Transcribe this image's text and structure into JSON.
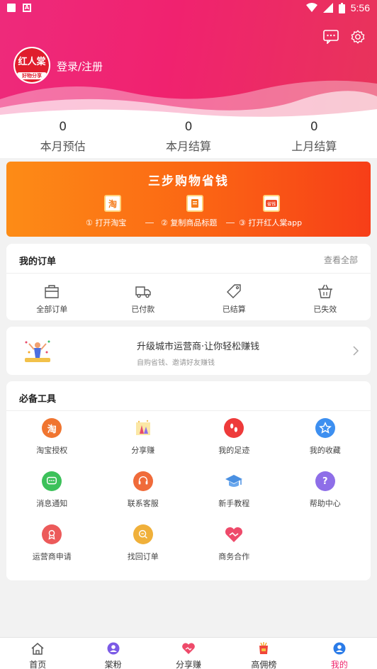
{
  "status_bar": {
    "time": "5:56"
  },
  "header": {
    "avatar_text": "红人棠",
    "avatar_sub": "好物分享",
    "login_label": "登录/注册"
  },
  "stats": [
    {
      "value": "0",
      "label": "本月预估"
    },
    {
      "value": "0",
      "label": "本月结算"
    },
    {
      "value": "0",
      "label": "上月结算"
    }
  ],
  "banner": {
    "title": "三步购物省钱",
    "steps": [
      {
        "num": "①",
        "label": "打开淘宝"
      },
      {
        "num": "②",
        "label": "复制商品标题"
      },
      {
        "num": "③",
        "label": "打开红人棠app"
      }
    ]
  },
  "orders": {
    "title": "我的订单",
    "more": "查看全部",
    "items": [
      {
        "label": "全部订单",
        "icon": "all-orders-icon"
      },
      {
        "label": "已付款",
        "icon": "truck-icon"
      },
      {
        "label": "已结算",
        "icon": "tag-icon"
      },
      {
        "label": "已失效",
        "icon": "basket-icon"
      }
    ]
  },
  "promo": {
    "title": "升级城市运营商·让你轻松赚钱",
    "subtitle": "自购省钱、邀请好友赚钱"
  },
  "tools": {
    "title": "必备工具",
    "items": [
      {
        "label": "淘宝授权",
        "icon": "taobao-icon",
        "color": "#f07530"
      },
      {
        "label": "分享赚",
        "icon": "share-earn-icon",
        "color": "#f4c35a"
      },
      {
        "label": "我的足迹",
        "icon": "footprint-icon",
        "color": "#ee3a3a"
      },
      {
        "label": "我的收藏",
        "icon": "star-icon",
        "color": "#3d8ff0"
      },
      {
        "label": "消息通知",
        "icon": "message-icon",
        "color": "#3cc15a"
      },
      {
        "label": "联系客服",
        "icon": "headset-icon",
        "color": "#f06b3a"
      },
      {
        "label": "新手教程",
        "icon": "graduation-cap-icon",
        "color": "#4a90e2"
      },
      {
        "label": "帮助中心",
        "icon": "help-icon",
        "color": "#8e6ee8"
      },
      {
        "label": "运营商申请",
        "icon": "badge-icon",
        "color": "#ec5a5a"
      },
      {
        "label": "找回订单",
        "icon": "search-order-icon",
        "color": "#f0b03a"
      },
      {
        "label": "商务合作",
        "icon": "handshake-icon",
        "color": "#ee4a6a"
      }
    ]
  },
  "nav": [
    {
      "label": "首页",
      "icon": "home-icon"
    },
    {
      "label": "棠粉",
      "icon": "fans-icon"
    },
    {
      "label": "分享赚",
      "icon": "share-icon"
    },
    {
      "label": "高佣榜",
      "icon": "ranking-icon"
    },
    {
      "label": "我的",
      "icon": "profile-icon",
      "active": true
    }
  ],
  "colors": {
    "brand": "#f0266d",
    "banner_start": "#fd8c16",
    "banner_end": "#f73e18"
  }
}
